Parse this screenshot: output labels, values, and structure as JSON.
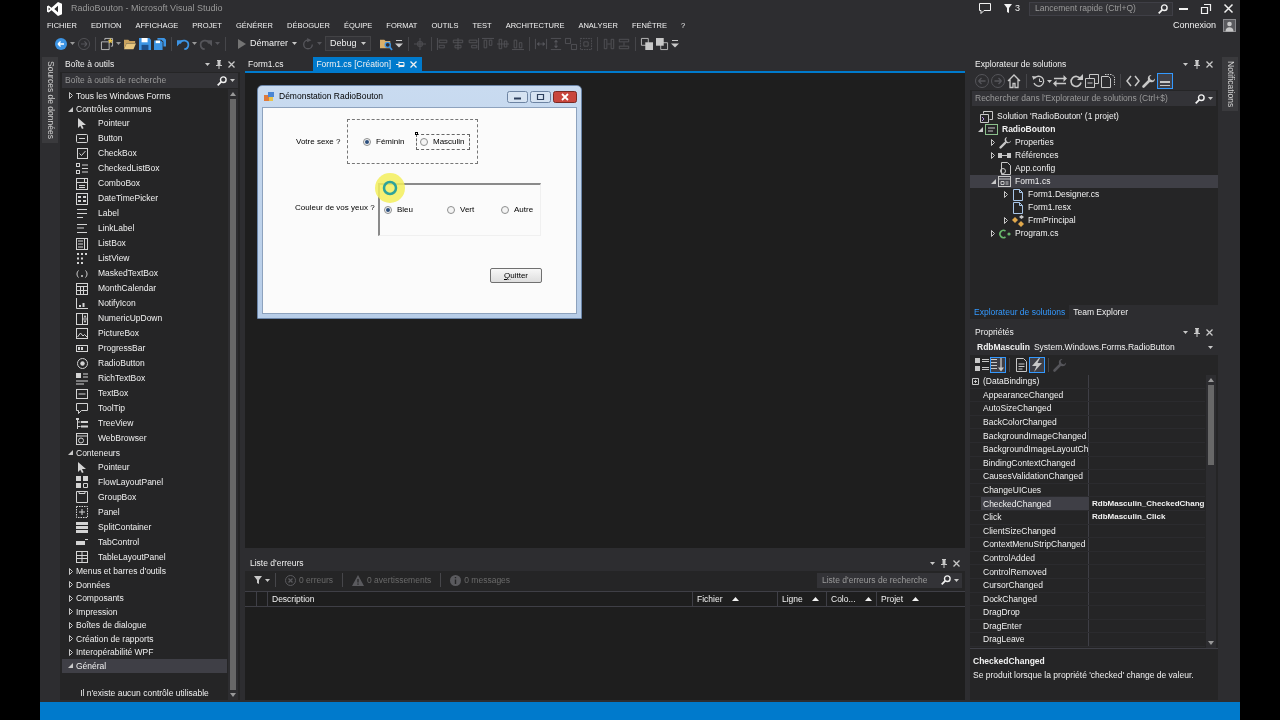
{
  "window": {
    "title": "RadioBouton - Microsoft Visual Studio",
    "notification_count": "3",
    "quick_launch": {
      "placeholder": "Lancement rapide (Ctrl+Q)"
    },
    "account": "Connexion"
  },
  "menu": [
    "FICHIER",
    "EDITION",
    "AFFICHAGE",
    "PROJET",
    "GÉNÉRER",
    "DÉBOGUER",
    "ÉQUIPE",
    "FORMAT",
    "OUTILS",
    "TEST",
    "ARCHITECTURE",
    "ANALYSER",
    "FENÊTRE",
    "?"
  ],
  "toolbar": [
    {
      "kind": "back",
      "disabled": false,
      "dropdown": true
    },
    {
      "kind": "forward",
      "disabled": true,
      "dropdown": false
    },
    {
      "kind": "separator"
    },
    {
      "kind": "new",
      "disabled": false,
      "dropdown": true
    },
    {
      "kind": "open",
      "disabled": false,
      "dropdown": false
    },
    {
      "kind": "save",
      "disabled": false,
      "dropdown": false
    },
    {
      "kind": "saveall",
      "disabled": false,
      "dropdown": false
    },
    {
      "kind": "separator"
    },
    {
      "kind": "undo",
      "disabled": false,
      "dropdown": true
    },
    {
      "kind": "redo",
      "disabled": true,
      "dropdown": true
    },
    {
      "kind": "separator"
    },
    {
      "kind": "start",
      "label": "Démarrer",
      "disabled": false,
      "dropdown": true
    },
    {
      "kind": "attach",
      "disabled": true,
      "dropdown": true
    },
    {
      "kind": "config",
      "label": "Debug",
      "disabled": false,
      "dropdown": true
    },
    {
      "kind": "find",
      "disabled": false,
      "dropdown": false
    },
    {
      "kind": "overflow"
    },
    {
      "kind": "separator"
    },
    {
      "kind": "snap",
      "disabled": true,
      "dropdown": false
    },
    {
      "kind": "separator"
    },
    {
      "kind": "alignleft",
      "disabled": true,
      "dropdown": false
    },
    {
      "kind": "aligncenter",
      "disabled": true,
      "dropdown": false
    },
    {
      "kind": "alignright",
      "disabled": true,
      "dropdown": false
    },
    {
      "kind": "aligntop",
      "disabled": true,
      "dropdown": false
    },
    {
      "kind": "alignmiddle",
      "disabled": true,
      "dropdown": false
    },
    {
      "kind": "alignbottom",
      "disabled": true,
      "dropdown": false
    },
    {
      "kind": "separator"
    },
    {
      "kind": "samewidth",
      "disabled": true,
      "dropdown": false
    },
    {
      "kind": "sameheight",
      "disabled": true,
      "dropdown": false
    },
    {
      "kind": "samesize",
      "disabled": true,
      "dropdown": false
    },
    {
      "kind": "sizegrid",
      "disabled": true,
      "dropdown": false
    },
    {
      "kind": "separator"
    },
    {
      "kind": "hspace",
      "disabled": true,
      "dropdown": false
    },
    {
      "kind": "vspace",
      "disabled": true,
      "dropdown": false
    },
    {
      "kind": "separator"
    },
    {
      "kind": "front",
      "disabled": false,
      "dropdown": false
    },
    {
      "kind": "sendback",
      "disabled": false,
      "dropdown": false
    },
    {
      "kind": "overflow"
    }
  ],
  "side_tabs": {
    "left": "Sources de données",
    "right": "Notifications"
  },
  "toolbox": {
    "title": "Boîte à outils",
    "search": {
      "placeholder": "Boîte à outils de recherche"
    },
    "groups": [
      {
        "label": "Tous les Windows Forms",
        "expanded": false,
        "selected": false
      },
      {
        "label": "Contrôles communs",
        "expanded": true,
        "selected": false,
        "children": [
          {
            "label": "Pointeur",
            "kind": "pointer"
          },
          {
            "label": "Button",
            "kind": "button"
          },
          {
            "label": "CheckBox",
            "kind": "checkbox"
          },
          {
            "label": "CheckedListBox",
            "kind": "checkedlist"
          },
          {
            "label": "ComboBox",
            "kind": "combobox"
          },
          {
            "label": "DateTimePicker",
            "kind": "datetime"
          },
          {
            "label": "Label",
            "kind": "label"
          },
          {
            "label": "LinkLabel",
            "kind": "linklabel"
          },
          {
            "label": "ListBox",
            "kind": "listbox"
          },
          {
            "label": "ListView",
            "kind": "listview"
          },
          {
            "label": "MaskedTextBox",
            "kind": "masked"
          },
          {
            "label": "MonthCalendar",
            "kind": "calendar"
          },
          {
            "label": "NotifyIcon",
            "kind": "notify"
          },
          {
            "label": "NumericUpDown",
            "kind": "numeric"
          },
          {
            "label": "PictureBox",
            "kind": "picture"
          },
          {
            "label": "ProgressBar",
            "kind": "progress"
          },
          {
            "label": "RadioButton",
            "kind": "radio"
          },
          {
            "label": "RichTextBox",
            "kind": "richtext"
          },
          {
            "label": "TextBox",
            "kind": "textbox"
          },
          {
            "label": "ToolTip",
            "kind": "tooltip"
          },
          {
            "label": "TreeView",
            "kind": "treeview"
          },
          {
            "label": "WebBrowser",
            "kind": "web"
          }
        ]
      },
      {
        "label": "Conteneurs",
        "expanded": true,
        "selected": false,
        "children": [
          {
            "label": "Pointeur",
            "kind": "pointer"
          },
          {
            "label": "FlowLayoutPanel",
            "kind": "flow"
          },
          {
            "label": "GroupBox",
            "kind": "groupbox"
          },
          {
            "label": "Panel",
            "kind": "panel"
          },
          {
            "label": "SplitContainer",
            "kind": "split"
          },
          {
            "label": "TabControl",
            "kind": "tabcontrol"
          },
          {
            "label": "TableLayoutPanel",
            "kind": "table"
          }
        ]
      },
      {
        "label": "Menus et barres d'outils",
        "expanded": false,
        "selected": false
      },
      {
        "label": "Données",
        "expanded": false,
        "selected": false
      },
      {
        "label": "Composants",
        "expanded": false,
        "selected": false
      },
      {
        "label": "Impression",
        "expanded": false,
        "selected": false
      },
      {
        "label": "Boîtes de dialogue",
        "expanded": false,
        "selected": false
      },
      {
        "label": "Création de rapports",
        "expanded": false,
        "selected": false
      },
      {
        "label": "Interopérabilité WPF",
        "expanded": false,
        "selected": false
      },
      {
        "label": "Général",
        "expanded": true,
        "selected": true,
        "empty_message": "Il n'existe aucun contrôle utilisable"
      }
    ]
  },
  "editor": {
    "tabs": [
      {
        "label": "Form1.cs",
        "selected": false
      },
      {
        "label": "Form1.cs [Création]",
        "selected": true
      }
    ],
    "form": {
      "title": "Démonstation RadioBouton",
      "fields": [
        {
          "label": "Votre sexe ?",
          "kind": "dashed",
          "options": [
            {
              "label": "Féminin",
              "checked": true,
              "selected": false
            },
            {
              "label": "Masculin",
              "checked": false,
              "selected": true
            }
          ]
        },
        {
          "label": "Couleur de vos yeux ?",
          "kind": "sunken",
          "options": [
            {
              "label": "Bleu",
              "checked": true,
              "selected": false
            },
            {
              "label": "Vert",
              "checked": false,
              "selected": false
            },
            {
              "label": "Autre",
              "checked": false,
              "selected": false
            }
          ]
        }
      ],
      "button": "Quitter"
    }
  },
  "error_list": {
    "title": "Liste d'erreurs",
    "filters": [
      {
        "label": "0 erreurs",
        "kind": "error",
        "disabled": true
      },
      {
        "label": "0 avertissements",
        "kind": "warning",
        "disabled": true
      },
      {
        "label": "0 messages",
        "kind": "message",
        "disabled": true
      }
    ],
    "search": {
      "placeholder": "Liste d'erreurs de recherche"
    },
    "columns": [
      {
        "label": "Description",
        "sorted": false
      },
      {
        "label": "Fichier",
        "sorted": true
      },
      {
        "label": "Ligne",
        "sorted": true
      },
      {
        "label": "Colo...",
        "sorted": true
      },
      {
        "label": "Projet",
        "sorted": true
      }
    ]
  },
  "solution_explorer": {
    "title": "Explorateur de solutions",
    "toolbar": [
      {
        "kind": "back",
        "disabled": true,
        "selected": false
      },
      {
        "kind": "forward",
        "disabled": true,
        "selected": false
      },
      {
        "kind": "home",
        "disabled": false,
        "selected": false
      },
      {
        "kind": "separator"
      },
      {
        "kind": "sync",
        "disabled": false,
        "selected": false,
        "dropdown": true
      },
      {
        "kind": "switch",
        "disabled": false,
        "selected": false
      },
      {
        "kind": "refresh",
        "disabled": false,
        "selected": false
      },
      {
        "kind": "collapse",
        "disabled": false,
        "selected": false
      },
      {
        "kind": "showall",
        "disabled": false,
        "selected": false
      },
      {
        "kind": "separator"
      },
      {
        "kind": "code",
        "disabled": false,
        "selected": false
      },
      {
        "kind": "wrench",
        "disabled": false,
        "selected": false
      },
      {
        "kind": "preview",
        "disabled": false,
        "selected": true
      }
    ],
    "search": {
      "placeholder": "Rechercher dans l'Explorateur de solutions (Ctrl+$)"
    },
    "tree": [
      {
        "label": "Solution 'RadioBouton' (1 projet)",
        "kind": "solution",
        "selected": false,
        "children": [
          {
            "label": "RadioBouton",
            "kind": "project",
            "startup": true,
            "expanded": true,
            "selected": false,
            "children": [
              {
                "label": "Properties",
                "kind": "properties",
                "expanded": false,
                "selected": false
              },
              {
                "label": "Références",
                "kind": "references",
                "expanded": false,
                "selected": false
              },
              {
                "label": "App.config",
                "kind": "config",
                "selected": false
              },
              {
                "label": "Form1.cs",
                "kind": "form",
                "expanded": true,
                "selected": true,
                "children": [
                  {
                    "label": "Form1.Designer.cs",
                    "kind": "file",
                    "expanded": false,
                    "selected": false
                  },
                  {
                    "label": "Form1.resx",
                    "kind": "file",
                    "selected": false
                  },
                  {
                    "label": "FrmPrincipal",
                    "kind": "class",
                    "expanded": false,
                    "selected": false
                  }
                ]
              },
              {
                "label": "Program.cs",
                "kind": "csharp",
                "expanded": false,
                "selected": false
              }
            ]
          }
        ]
      }
    ],
    "tabs": [
      {
        "label": "Explorateur de solutions",
        "selected": true
      },
      {
        "label": "Team Explorer",
        "selected": false
      }
    ]
  },
  "properties": {
    "title": "Propriétés",
    "object": {
      "name": "RdbMasculin",
      "type": "System.Windows.Forms.RadioButton"
    },
    "toolbar": [
      {
        "kind": "categorized",
        "disabled": false,
        "selected": false
      },
      {
        "kind": "alphabetical",
        "disabled": false,
        "selected": true
      },
      {
        "kind": "separator"
      },
      {
        "kind": "propertypage",
        "disabled": false,
        "selected": false
      },
      {
        "kind": "events",
        "disabled": false,
        "selected": true
      },
      {
        "kind": "separator"
      },
      {
        "kind": "wrench",
        "disabled": true,
        "selected": false
      }
    ],
    "rows": [
      {
        "name": "(DataBindings)",
        "kind": "group",
        "selected": false
      },
      {
        "name": "AppearanceChanged",
        "kind": "event",
        "selected": false
      },
      {
        "name": "AutoSizeChanged",
        "kind": "event",
        "selected": false
      },
      {
        "name": "BackColorChanged",
        "kind": "event",
        "selected": false
      },
      {
        "name": "BackgroundImageChanged",
        "kind": "event",
        "selected": false
      },
      {
        "name": "BackgroundImageLayoutCh",
        "kind": "event",
        "selected": false
      },
      {
        "name": "BindingContextChanged",
        "kind": "event",
        "selected": false
      },
      {
        "name": "CausesValidationChanged",
        "kind": "event",
        "selected": false
      },
      {
        "name": "ChangeUICues",
        "kind": "event",
        "selected": false
      },
      {
        "name": "CheckedChanged",
        "kind": "event",
        "selected": true,
        "value": "RdbMasculin_CheckedChang"
      },
      {
        "name": "Click",
        "kind": "event",
        "selected": false,
        "value": "RdbMasculin_Click"
      },
      {
        "name": "ClientSizeChanged",
        "kind": "event",
        "selected": false
      },
      {
        "name": "ContextMenuStripChanged",
        "kind": "event",
        "selected": false
      },
      {
        "name": "ControlAdded",
        "kind": "event",
        "selected": false
      },
      {
        "name": "ControlRemoved",
        "kind": "event",
        "selected": false
      },
      {
        "name": "CursorChanged",
        "kind": "event",
        "selected": false
      },
      {
        "name": "DockChanged",
        "kind": "event",
        "selected": false
      },
      {
        "name": "DragDrop",
        "kind": "event",
        "selected": false
      },
      {
        "name": "DragEnter",
        "kind": "event",
        "selected": false
      },
      {
        "name": "DragLeave",
        "kind": "event",
        "selected": false
      }
    ],
    "description": {
      "title": "CheckedChanged",
      "text": "Se produit lorsque la propriété 'checked' change de valeur."
    }
  }
}
